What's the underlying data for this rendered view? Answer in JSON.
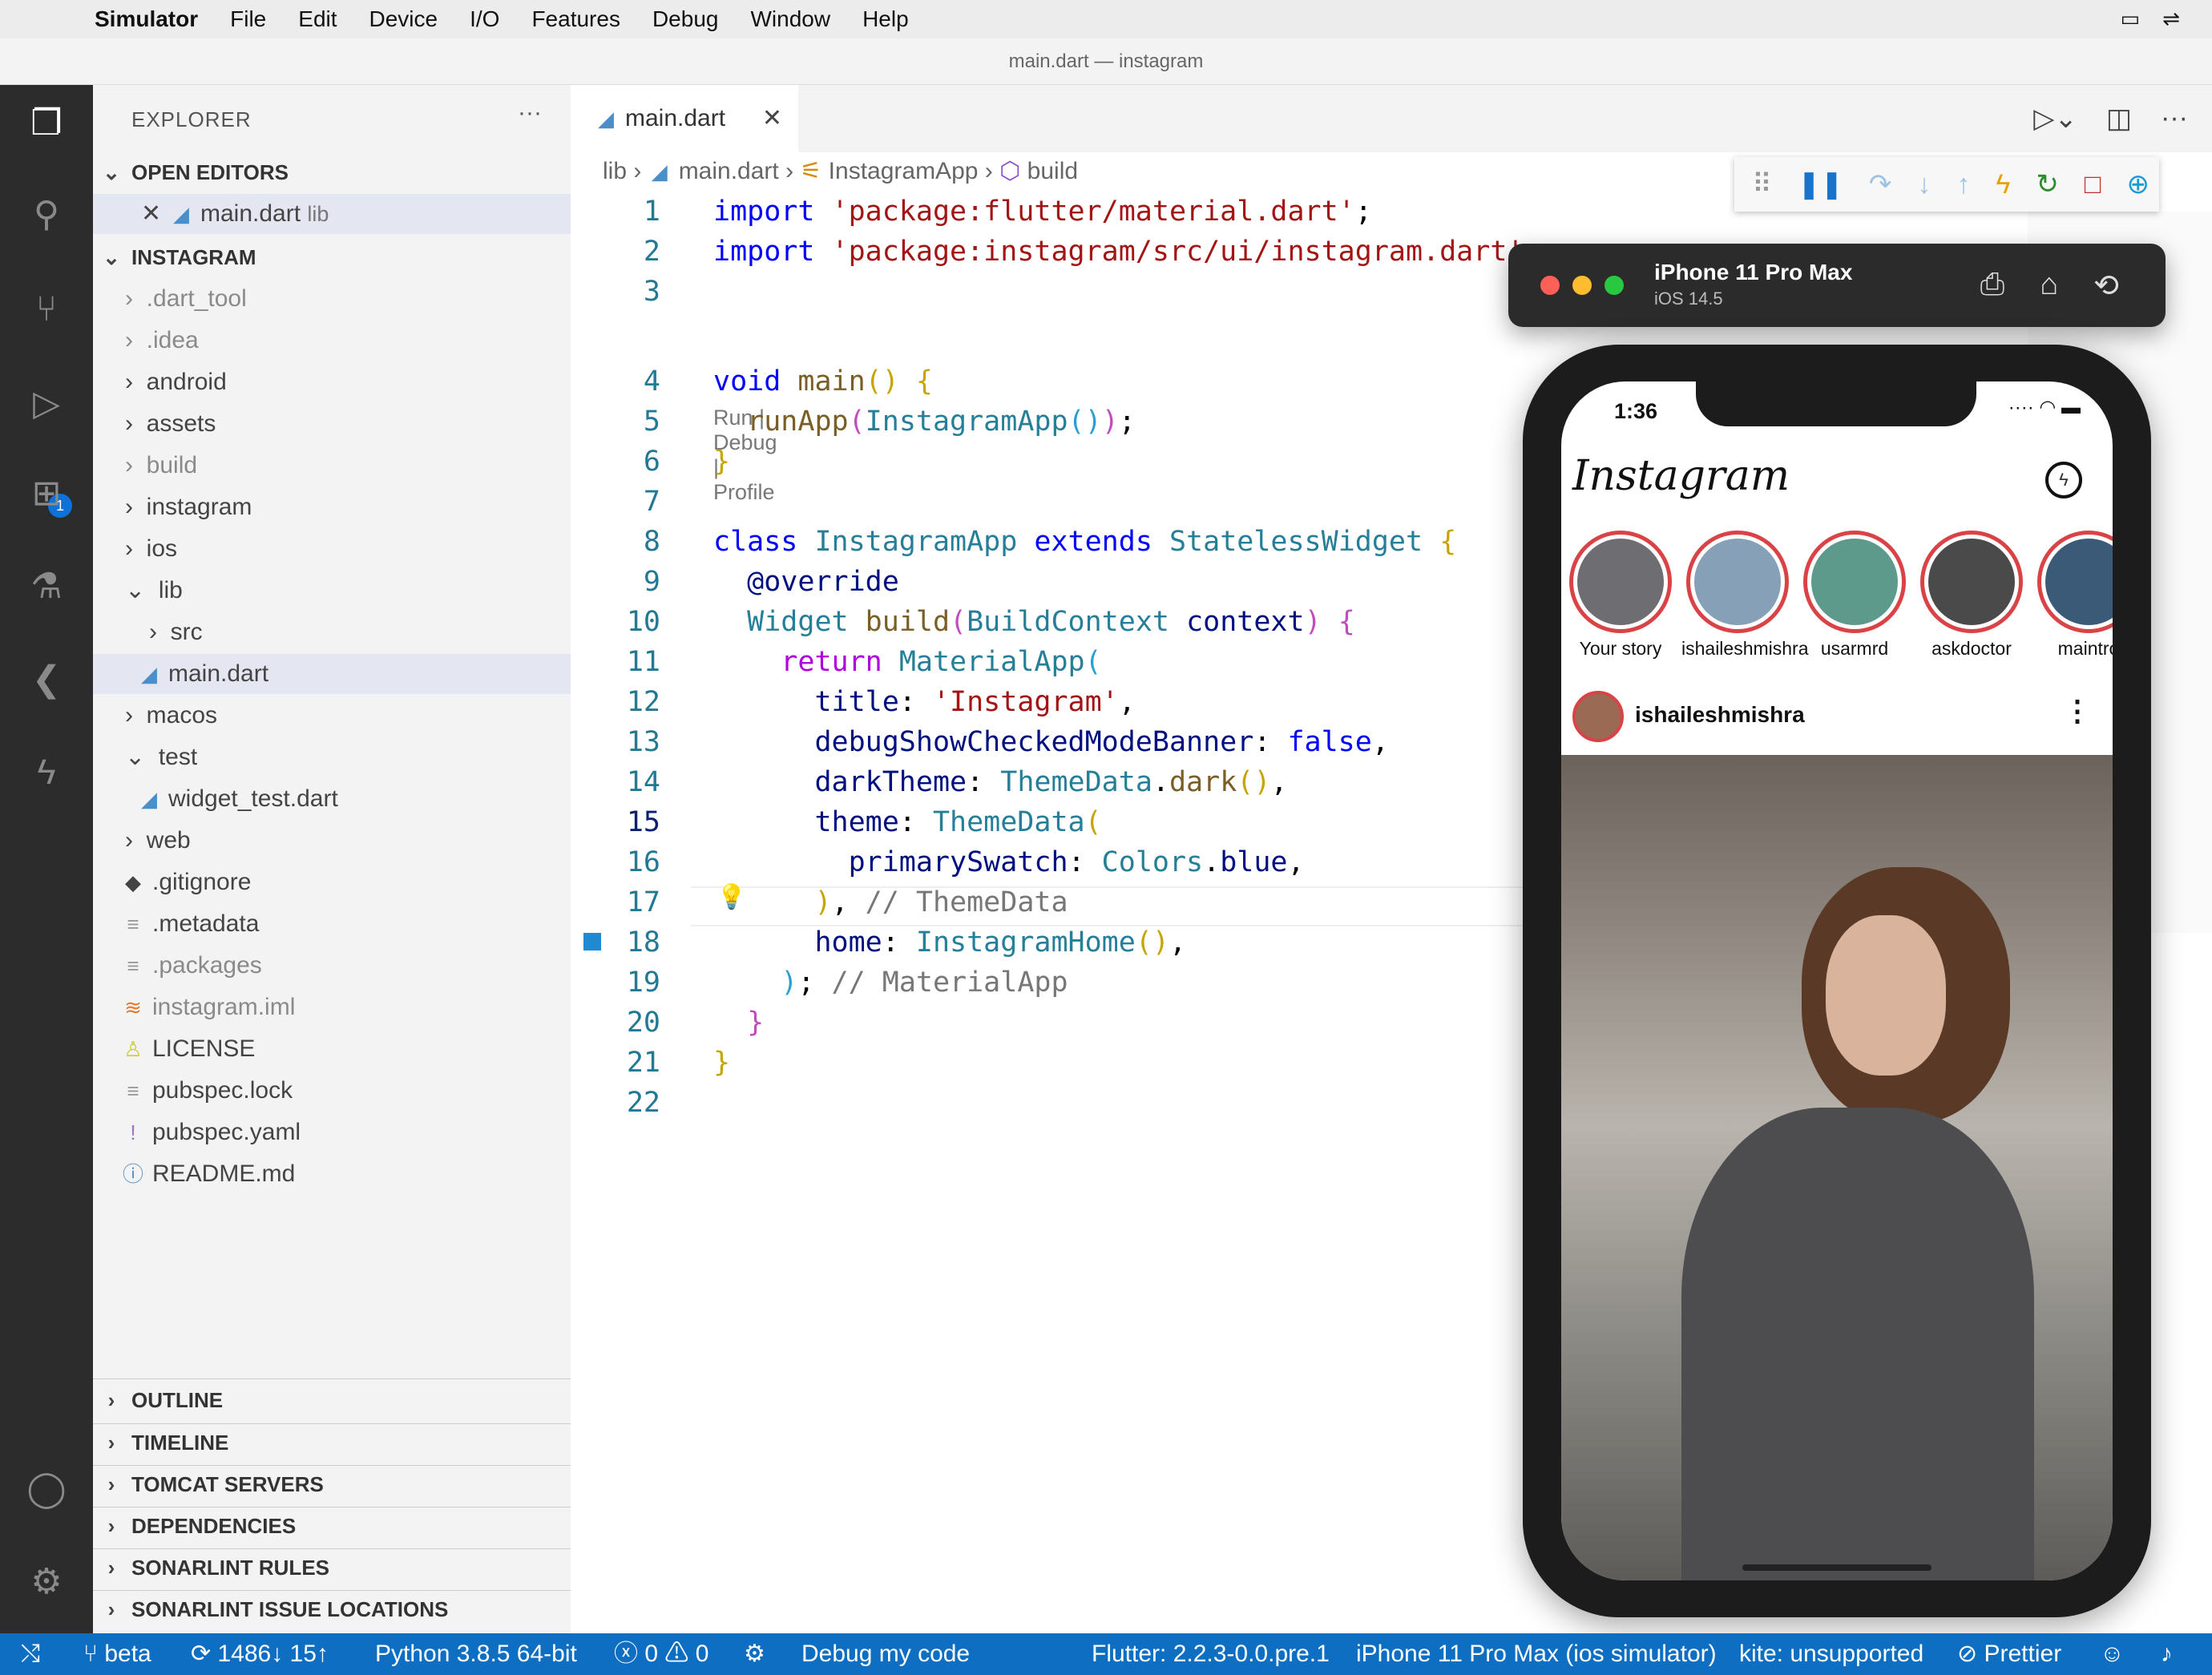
{
  "menubar": {
    "app": "Simulator",
    "items": [
      "File",
      "Edit",
      "Device",
      "I/O",
      "Features",
      "Debug",
      "Window",
      "Help"
    ]
  },
  "window": {
    "title": "main.dart — instagram"
  },
  "sidebar": {
    "title": "EXPLORER",
    "more": "···",
    "open_editors": "OPEN EDITORS",
    "open_file": "main.dart",
    "open_file_dir": "lib",
    "project": "INSTAGRAM",
    "tree": [
      ".dart_tool",
      ".idea",
      "android",
      "assets",
      "build",
      "instagram",
      "ios",
      "lib",
      "src",
      "main.dart",
      "macos",
      "test",
      "widget_test.dart",
      "web",
      ".gitignore",
      ".metadata",
      ".packages",
      "instagram.iml",
      "LICENSE",
      "pubspec.lock",
      "pubspec.yaml",
      "README.md"
    ],
    "bottom_sections": [
      "OUTLINE",
      "TIMELINE",
      "TOMCAT SERVERS",
      "DEPENDENCIES",
      "SONARLINT RULES",
      "SONARLINT ISSUE LOCATIONS"
    ]
  },
  "activity": {
    "badge": "1"
  },
  "editor": {
    "tab": "main.dart",
    "breadcrumb": [
      "lib",
      "main.dart",
      "InstagramApp",
      "build"
    ],
    "codelens": "Run | Debug | Profile",
    "line_numbers": [
      "1",
      "2",
      "3",
      "4",
      "5",
      "6",
      "7",
      "8",
      "9",
      "10",
      "11",
      "12",
      "13",
      "14",
      "15",
      "16",
      "17",
      "18",
      "19",
      "20",
      "21",
      "22"
    ]
  },
  "simulator": {
    "device": "iPhone 11 Pro Max",
    "os": "iOS 14.5"
  },
  "phone": {
    "time": "1:36",
    "app_logo": "Instagram",
    "stories": [
      "Your story",
      "ishaileshmishra",
      "usarmrd",
      "askdoctor",
      "maintro"
    ],
    "post_user": "ishaileshmishra"
  },
  "statusbar": {
    "branch": "beta",
    "sync": "1486↓ 15↑",
    "python": "Python 3.8.5 64-bit",
    "errors": "0",
    "warnings": "0",
    "debug": "Debug my code",
    "flutter": "Flutter: 2.2.3-0.0.pre.1",
    "device": "iPhone 11 Pro Max (ios simulator)",
    "kite": "kite: unsupported",
    "prettier": "Prettier"
  }
}
